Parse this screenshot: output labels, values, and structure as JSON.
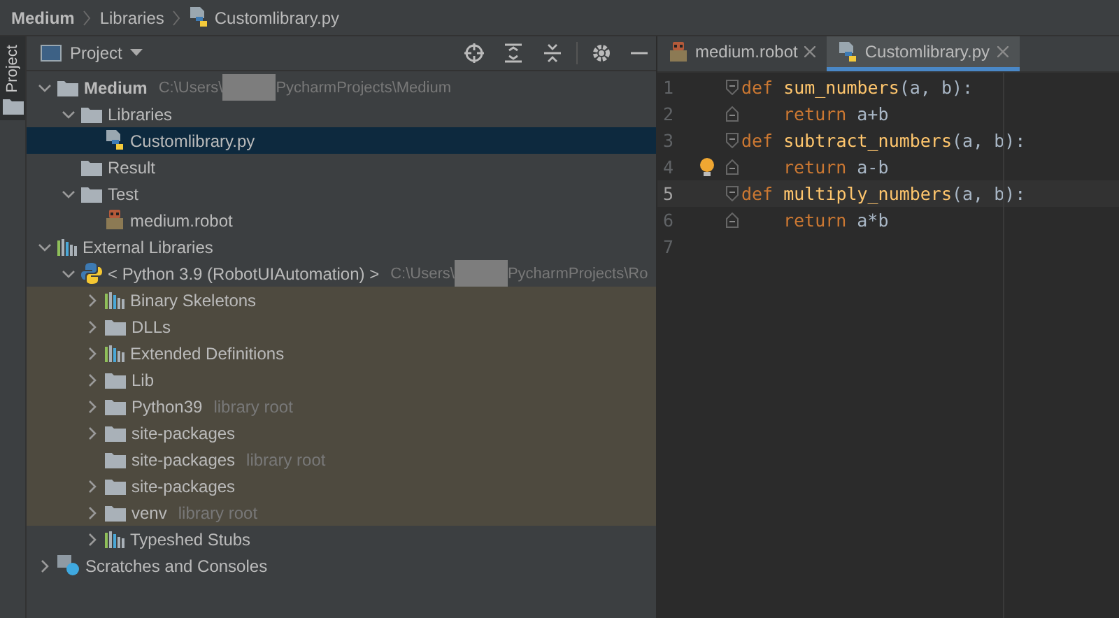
{
  "breadcrumbs": [
    {
      "label": "Medium",
      "kind": "folder"
    },
    {
      "label": "Libraries",
      "kind": "folder"
    },
    {
      "label": "Customlibrary.py",
      "kind": "python-file"
    }
  ],
  "side_tab": {
    "label": "Project",
    "selected": true
  },
  "project_panel": {
    "title": "Project"
  },
  "tree": [
    {
      "label": "Medium",
      "kind": "folder",
      "bold": true,
      "expanded": true,
      "selected": false,
      "shaded": false,
      "path": [
        "C:\\Users\\",
        "PycharmProjects\\Medium"
      ],
      "children": [
        {
          "label": "Libraries",
          "kind": "folder",
          "expanded": true,
          "selected": false,
          "shaded": false,
          "children": [
            {
              "label": "Customlibrary.py",
              "kind": "python-file",
              "selected": true,
              "shaded": false
            }
          ]
        },
        {
          "label": "Result",
          "kind": "folder",
          "selected": false,
          "shaded": false
        },
        {
          "label": "Test",
          "kind": "folder",
          "expanded": true,
          "selected": false,
          "shaded": false,
          "children": [
            {
              "label": "medium.robot",
              "kind": "robot",
              "selected": false,
              "shaded": false
            }
          ]
        }
      ]
    },
    {
      "label": "External Libraries",
      "kind": "libraries",
      "expanded": true,
      "selected": false,
      "shaded": false,
      "children": [
        {
          "label": "< Python 3.9 (RobotUIAutomation) >",
          "kind": "python",
          "expanded": true,
          "selected": false,
          "shaded": false,
          "path": [
            "C:\\Users\\",
            "PycharmProjects\\Ro"
          ],
          "children": [
            {
              "label": "Binary Skeletons",
              "kind": "libraries",
              "expanded": false,
              "selected": false,
              "shaded": true
            },
            {
              "label": "DLLs",
              "kind": "folder",
              "expanded": false,
              "selected": false,
              "shaded": true
            },
            {
              "label": "Extended Definitions",
              "kind": "libraries",
              "expanded": false,
              "selected": false,
              "shaded": true
            },
            {
              "label": "Lib",
              "kind": "folder",
              "expanded": false,
              "selected": false,
              "shaded": true
            },
            {
              "label": "Python39",
              "kind": "folder",
              "expanded": false,
              "selected": false,
              "shaded": true,
              "note": "library root"
            },
            {
              "label": "site-packages",
              "kind": "folder",
              "expanded": false,
              "selected": false,
              "shaded": true
            },
            {
              "label": "site-packages",
              "kind": "folder",
              "selected": false,
              "shaded": true,
              "note": "library root"
            },
            {
              "label": "site-packages",
              "kind": "folder",
              "expanded": false,
              "selected": false,
              "shaded": true
            },
            {
              "label": "venv",
              "kind": "folder",
              "expanded": false,
              "selected": false,
              "shaded": true,
              "note": "library root"
            },
            {
              "label": "Typeshed Stubs",
              "kind": "libraries",
              "expanded": false,
              "selected": false,
              "shaded": false
            }
          ]
        }
      ]
    },
    {
      "label": "Scratches and Consoles",
      "kind": "scratches",
      "expanded": false,
      "selected": false,
      "shaded": false
    }
  ],
  "editor_tabs": [
    {
      "label": "medium.robot",
      "kind": "robot",
      "selected": false
    },
    {
      "label": "Customlibrary.py",
      "kind": "python-file",
      "selected": true
    }
  ],
  "code_lines": [
    {
      "number": "1",
      "selected": false,
      "kind": "block-start",
      "indented": false,
      "tokens": [
        {
          "kind": "keyword",
          "text": "def"
        },
        {
          "kind": "function",
          "text": "sum_numbers"
        },
        {
          "kind": "plain",
          "text": "(a, b):"
        }
      ]
    },
    {
      "number": "2",
      "selected": false,
      "kind": "block-end",
      "indented": true,
      "tokens": [
        {
          "kind": "keyword",
          "text": "return"
        },
        {
          "kind": "plain",
          "text": "a+b"
        }
      ]
    },
    {
      "number": "3",
      "selected": false,
      "kind": "block-start",
      "indented": false,
      "tokens": [
        {
          "kind": "keyword",
          "text": "def"
        },
        {
          "kind": "function",
          "text": "subtract_numbers"
        },
        {
          "kind": "plain",
          "text": "(a, b):"
        }
      ]
    },
    {
      "number": "4",
      "selected": false,
      "hint": true,
      "kind": "block-end",
      "indented": true,
      "tokens": [
        {
          "kind": "keyword",
          "text": "return"
        },
        {
          "kind": "plain",
          "text": "a-b"
        }
      ]
    },
    {
      "number": "5",
      "selected": true,
      "kind": "block-start",
      "indented": false,
      "tokens": [
        {
          "kind": "keyword",
          "text": "def"
        },
        {
          "kind": "function",
          "text": "multiply_numbers"
        },
        {
          "kind": "plain",
          "text": "(a, b):"
        }
      ]
    },
    {
      "number": "6",
      "selected": false,
      "kind": "block-end",
      "indented": true,
      "tokens": [
        {
          "kind": "keyword",
          "text": "return"
        },
        {
          "kind": "plain",
          "text": "a*b"
        }
      ]
    },
    {
      "number": "7",
      "selected": false,
      "kind": "empty"
    }
  ]
}
